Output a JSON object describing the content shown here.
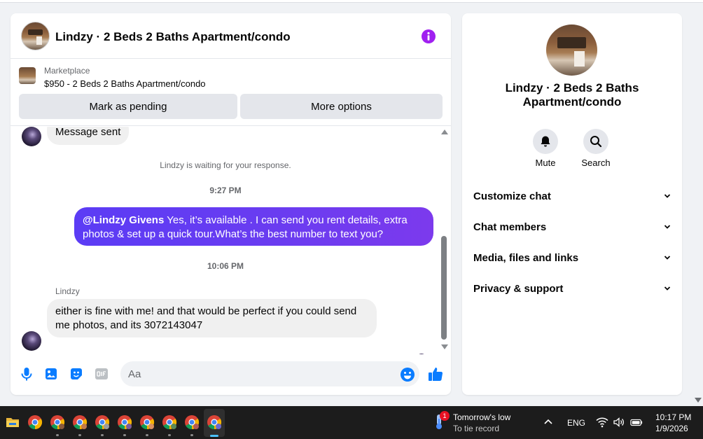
{
  "chat": {
    "title": "Lindzy · 2 Beds 2 Baths Apartment/condo",
    "listing": {
      "source": "Marketplace",
      "price_line": "$950 - 2 Beds 2 Baths Apartment/condo"
    },
    "buttons": {
      "mark_pending": "Mark as pending",
      "more_options": "More options"
    },
    "messages": {
      "prev_message": "Message sent",
      "waiting_notice": "Lindzy is waiting for your response.",
      "time_1": "9:27 PM",
      "outgoing_mention": "@Lindzy Givens",
      "outgoing_text": " Yes, it’s available .  I can send you rent details, extra photos & set up a quick tour.What’s the best number to text you?",
      "time_2": "10:06 PM",
      "sender": "Lindzy",
      "incoming_text": "either is fine with me! and that would be perfect if you could send me photos, and its 3072143047"
    },
    "composer": {
      "placeholder": "Aa"
    },
    "colors": {
      "accent": "#6b3cf0",
      "info_icon": "#a020f0",
      "composer_icons": "#0a7cff"
    }
  },
  "info_panel": {
    "title": "Lindzy · 2 Beds 2 Baths Apartment/condo",
    "actions": {
      "mute": "Mute",
      "search": "Search"
    },
    "sections": [
      "Customize chat",
      "Chat members",
      "Media, files and links",
      "Privacy & support"
    ]
  },
  "taskbar": {
    "weather": {
      "badge": "1",
      "title": "Tomorrow's low",
      "subtitle": "To tie record"
    },
    "language": "ENG",
    "time": "10:17 PM",
    "date": "1/9/2026"
  }
}
